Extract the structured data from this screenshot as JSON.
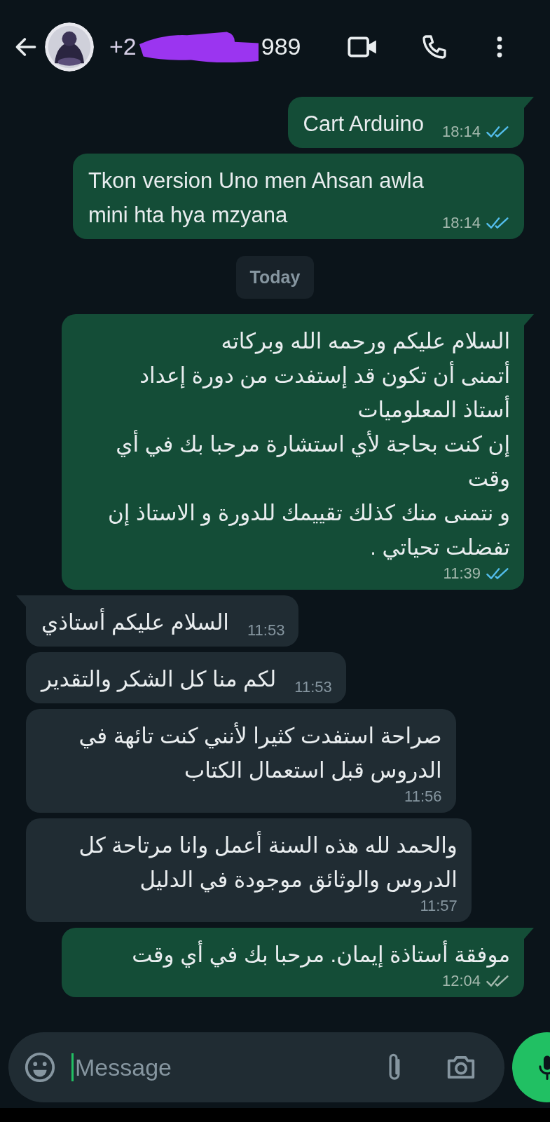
{
  "header": {
    "contact_name_start": "+2",
    "contact_name_end": "989"
  },
  "messages": [
    {
      "kind": "outgoing",
      "text": "Cart Arduino",
      "time": "18:14",
      "read": true,
      "tail": true
    },
    {
      "kind": "outgoing",
      "text": "Tkon version Uno men Ahsan awla\nmini hta hya mzyana",
      "time": "18:14",
      "read": true,
      "tail": false
    },
    {
      "kind": "date",
      "text": "Today"
    },
    {
      "kind": "outgoing",
      "text": "السلام عليكم ورحمه الله وبركاته\nأتمنى أن تكون قد إستفدت من دورة إعداد\nأستاذ المعلوميات\nإن كنت بحاجة لأي استشارة مرحبا بك في أي\nوقت\nو نتمنى منك كذلك تقييمك للدورة و الاستاذ إن\nتفضلت تحياتي .",
      "time": "11:39",
      "read": true,
      "tail": true
    },
    {
      "kind": "incoming",
      "text": "السلام عليكم أستاذي",
      "time": "11:53",
      "tail": true
    },
    {
      "kind": "incoming",
      "text": "لكم منا كل الشكر والتقدير",
      "time": "11:53",
      "tail": false
    },
    {
      "kind": "incoming",
      "text": "صراحة استفدت كثيرا لأنني كنت تائهة في\nالدروس قبل استعمال الكتاب",
      "time": "11:56",
      "tail": false
    },
    {
      "kind": "incoming",
      "text": "والحمد لله هذه السنة أعمل وانا مرتاحة كل\nالدروس والوثائق موجودة في الدليل",
      "time": "11:57",
      "tail": false
    },
    {
      "kind": "outgoing",
      "text": "موفقة أستاذة إيمان. مرحبا بك في أي وقت",
      "time": "12:04",
      "read": false,
      "tail": true
    }
  ],
  "composer": {
    "placeholder": "Message"
  }
}
